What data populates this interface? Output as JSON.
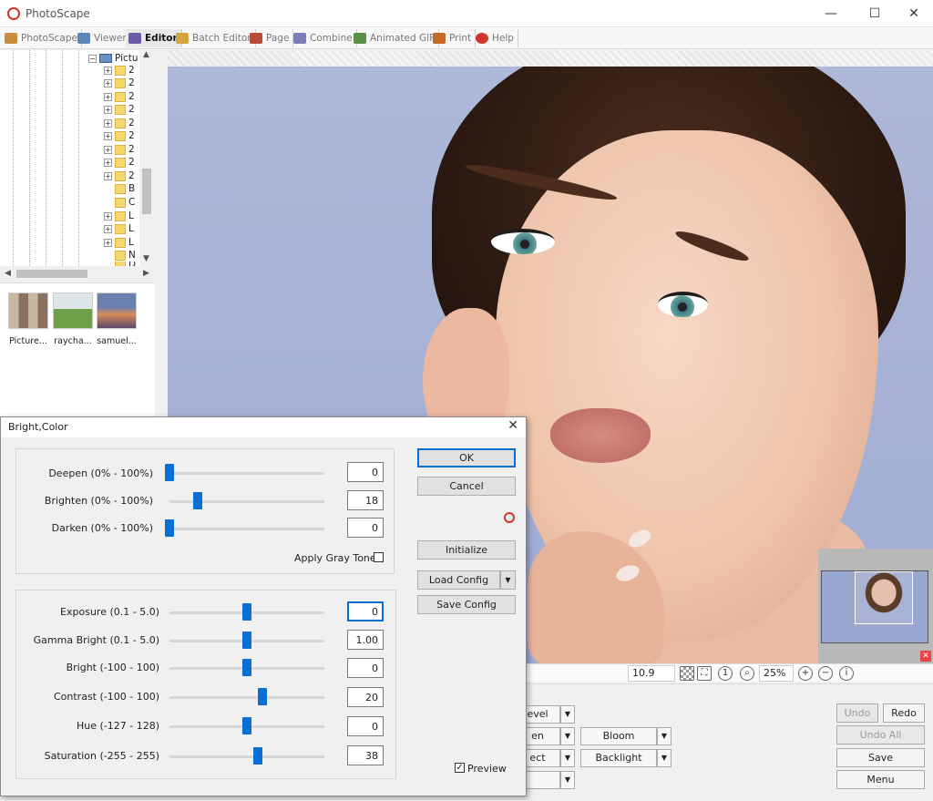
{
  "app": {
    "title": "PhotoScape",
    "window_controls": [
      "—",
      "☐",
      "✕"
    ]
  },
  "tabs": [
    {
      "label": "PhotoScape",
      "icon": "photoscape-icon",
      "color": "#c98c3a"
    },
    {
      "label": "Viewer",
      "icon": "viewer-icon",
      "color": "#5b86b8"
    },
    {
      "label": "Editor",
      "icon": "editor-icon",
      "color": "#6b5ba8",
      "active": true
    },
    {
      "label": "Batch Editor",
      "icon": "batch-editor-icon",
      "color": "#d3a640"
    },
    {
      "label": "Page",
      "icon": "page-icon",
      "color": "#b84a3a"
    },
    {
      "label": "Combine",
      "icon": "combine-icon",
      "color": "#7a7fb5"
    },
    {
      "label": "Animated GIF",
      "icon": "animated-gif-icon",
      "color": "#5a8f48"
    },
    {
      "label": "Print",
      "icon": "print-icon",
      "color": "#c66a2a"
    },
    {
      "label": "Help",
      "icon": "help-icon",
      "color": "#d2342b"
    }
  ],
  "tree": {
    "root_label": "Pictu",
    "items": [
      "2",
      "2",
      "2",
      "2",
      "2",
      "2",
      "2",
      "2",
      "2",
      "B",
      "C",
      "L",
      "L",
      "L",
      "N",
      "D"
    ]
  },
  "thumbnails": [
    {
      "caption": "Picture..."
    },
    {
      "caption": "raycha..."
    },
    {
      "caption": "samuel..."
    }
  ],
  "status": {
    "file_size": "10.9 MB",
    "zoom": "25%"
  },
  "bottom_panel": {
    "combos": [
      {
        "label": "evel"
      },
      {
        "label": "en"
      },
      {
        "label": "ect"
      },
      {
        "label": ""
      },
      {
        "label": "Bloom"
      },
      {
        "label": "Backlight"
      }
    ],
    "undo": "Undo",
    "redo": "Redo",
    "undo_all": "Undo All",
    "save": "Save",
    "menu": "Menu"
  },
  "dialog": {
    "title": "Bright,Color",
    "close": "✕",
    "group1": [
      {
        "label": "Deepen (0% - 100%)",
        "value": "0",
        "level": 0.0
      },
      {
        "label": "Brighten (0% - 100%)",
        "value": "18",
        "level": 0.18
      },
      {
        "label": "Darken (0% - 100%)",
        "value": "0",
        "level": 0.0
      }
    ],
    "apply_gray_tone": "Apply Gray Tone",
    "group2": [
      {
        "label": "Exposure (0.1 - 5.0)",
        "value": "0",
        "level": 0.5
      },
      {
        "label": "Gamma Bright (0.1 - 5.0)",
        "value": "1.00",
        "level": 0.5
      },
      {
        "label": "Bright (-100 - 100)",
        "value": "0",
        "level": 0.5
      },
      {
        "label": "Contrast (-100 - 100)",
        "value": "20",
        "level": 0.6
      },
      {
        "label": "Hue (-127 - 128)",
        "value": "0",
        "level": 0.5
      },
      {
        "label": "Saturation (-255 - 255)",
        "value": "38",
        "level": 0.57
      }
    ],
    "ok": "OK",
    "cancel": "Cancel",
    "initialize": "Initialize",
    "load_config": "Load Config",
    "save_config": "Save Config",
    "preview": "Preview",
    "preview_checked": true,
    "accent_color": "#0a6fd2"
  }
}
